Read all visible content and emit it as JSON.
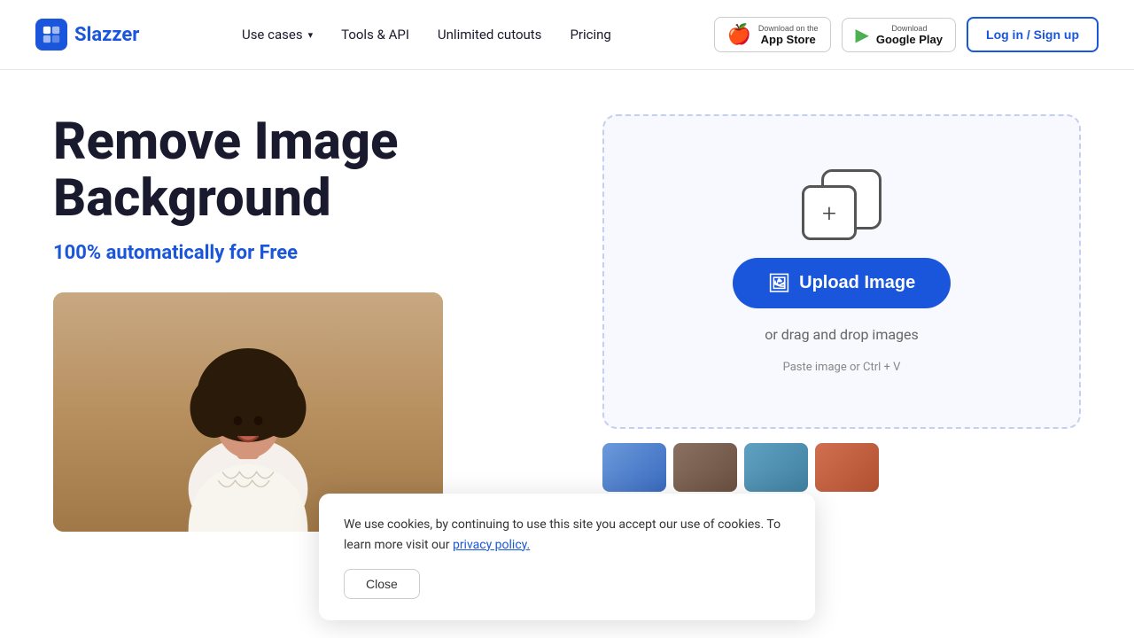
{
  "navbar": {
    "logo_text": "Slazzer",
    "links": [
      {
        "label": "Use cases",
        "has_dropdown": true
      },
      {
        "label": "Tools & API",
        "has_dropdown": false
      },
      {
        "label": "Unlimited cutouts",
        "has_dropdown": false
      },
      {
        "label": "Pricing",
        "has_dropdown": false
      }
    ],
    "app_store": {
      "sub": "Download on the",
      "name": "App Store"
    },
    "google_play": {
      "sub": "Download",
      "name": "Google Play"
    },
    "login_label": "Log in / Sign up"
  },
  "hero": {
    "title": "Remove Image Background",
    "subtitle_prefix": "100% automatically for ",
    "subtitle_accent": "Free"
  },
  "upload": {
    "button_label": "Upload Image",
    "drag_text": "or drag and drop images",
    "paste_text": "Paste image or Ctrl + V"
  },
  "cookie": {
    "message": "We use cookies, by continuing to use this site you accept our use of cookies.  To learn more visit our ",
    "link_text": "privacy policy.",
    "close_label": "Close"
  }
}
